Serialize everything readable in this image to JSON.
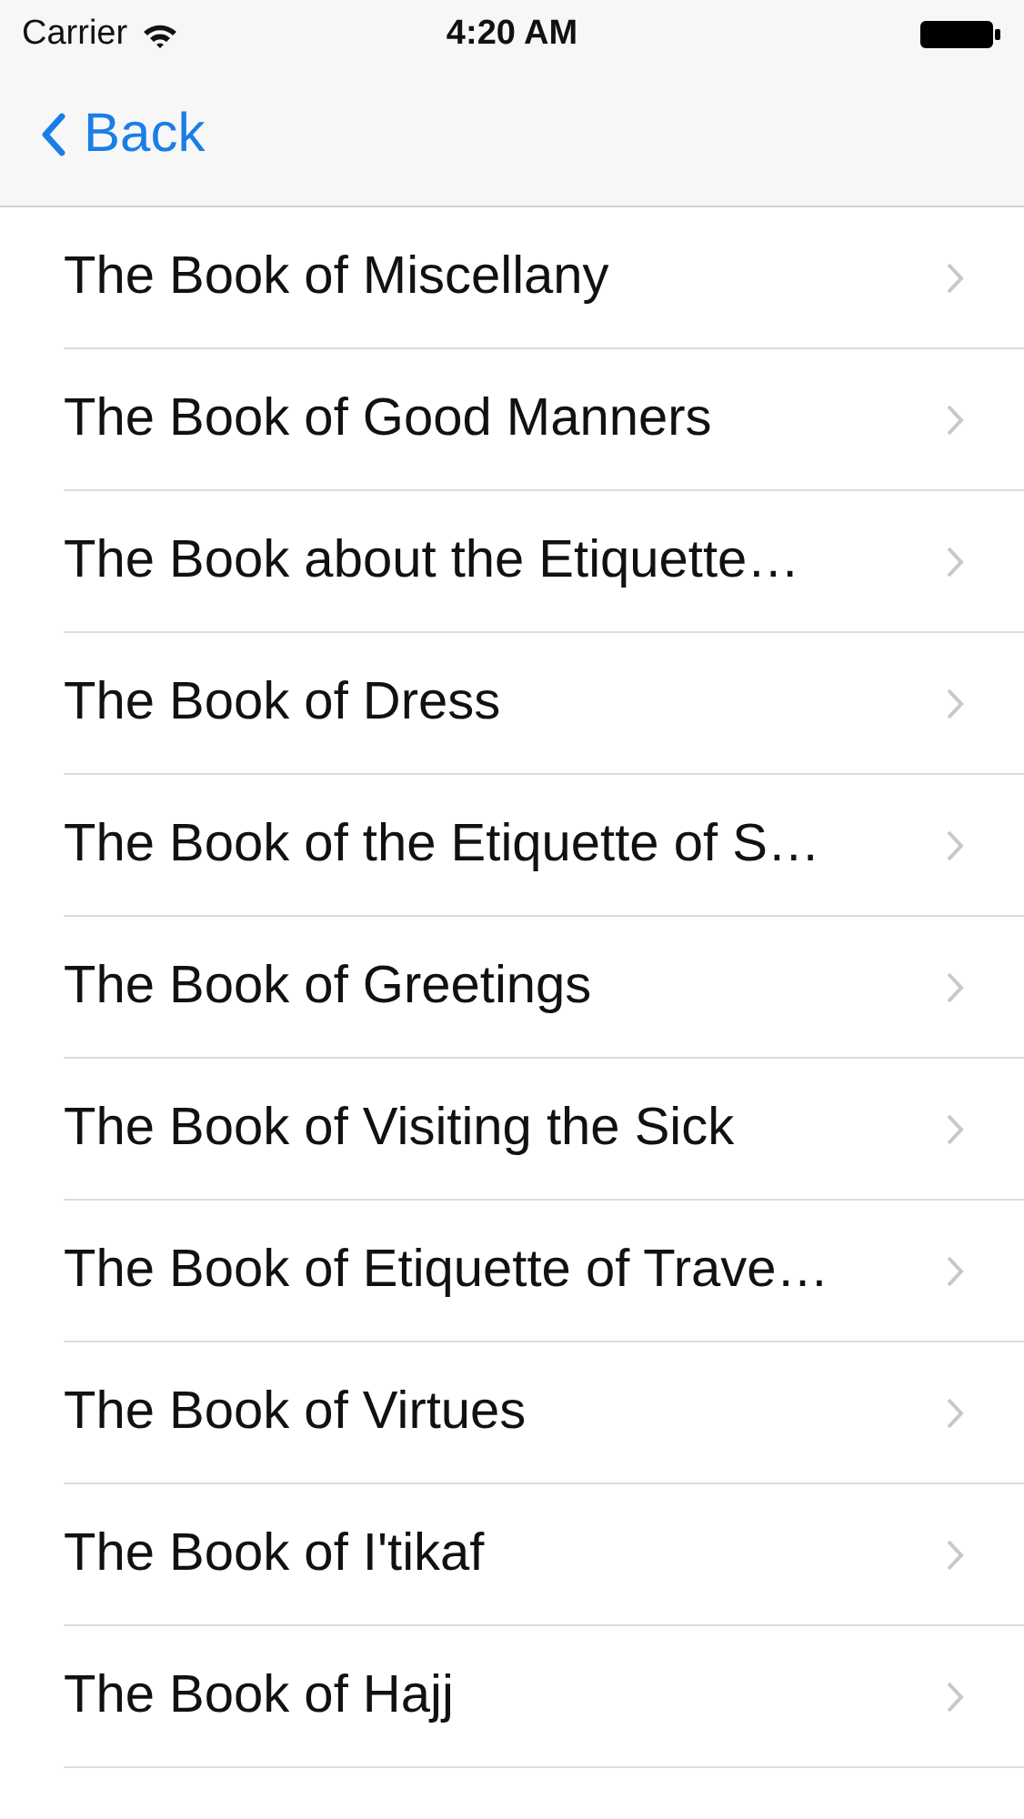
{
  "status_bar": {
    "carrier": "Carrier",
    "time": "4:20 AM"
  },
  "nav": {
    "back": "Back"
  },
  "items": [
    {
      "title": "The Book of Miscellany"
    },
    {
      "title": "The Book of Good Manners"
    },
    {
      "title": "The Book about the Etiquette…"
    },
    {
      "title": "The Book of Dress"
    },
    {
      "title": "The Book of the Etiquette of S…"
    },
    {
      "title": "The Book of Greetings"
    },
    {
      "title": "The Book of Visiting the Sick"
    },
    {
      "title": "The Book of Etiquette of Trave…"
    },
    {
      "title": "The Book of Virtues"
    },
    {
      "title": "The Book of I'tikaf"
    },
    {
      "title": "The Book of Hajj"
    }
  ]
}
